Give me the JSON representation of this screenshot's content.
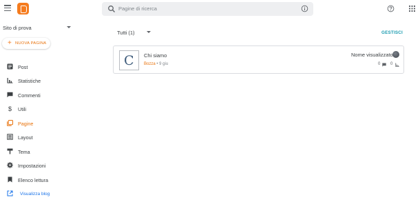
{
  "header": {
    "search_placeholder": "Pagine di ricerca",
    "icons": [
      "menu-icon",
      "blogger-logo",
      "search-icon",
      "info-icon",
      "help-icon",
      "apps-icon"
    ]
  },
  "sidebar": {
    "blog_name": "Sito di prova",
    "new_page_label": "NUOVA PAGINA",
    "items": [
      {
        "label": "Post",
        "icon": "post-icon"
      },
      {
        "label": "Statistiche",
        "icon": "stats-icon"
      },
      {
        "label": "Commenti",
        "icon": "comment-icon"
      },
      {
        "label": "Utili",
        "icon": "dollar-icon"
      },
      {
        "label": "Pagine",
        "icon": "pages-icon",
        "active": true
      },
      {
        "label": "Layout",
        "icon": "layout-icon"
      },
      {
        "label": "Tema",
        "icon": "paint-roller-icon"
      },
      {
        "label": "Impostazioni",
        "icon": "gear-icon"
      },
      {
        "label": "Elenco lettura",
        "icon": "bookmark-icon"
      }
    ],
    "view_blog_label": "Visualizza blog"
  },
  "main": {
    "filter_label": "Tutti (1)",
    "publish_label": "GESTISCI",
    "pages": [
      {
        "thumb_letter": "C",
        "title": "Chi siamo",
        "status": "Bozza",
        "date": "9 giu",
        "author": "Nome visualizzato",
        "comments": "0",
        "views": "0"
      }
    ]
  },
  "colors": {
    "accent": "#e8710a",
    "logo": "#f57c1f",
    "link": "#1a73e8",
    "teal": "#1a9bb0"
  }
}
